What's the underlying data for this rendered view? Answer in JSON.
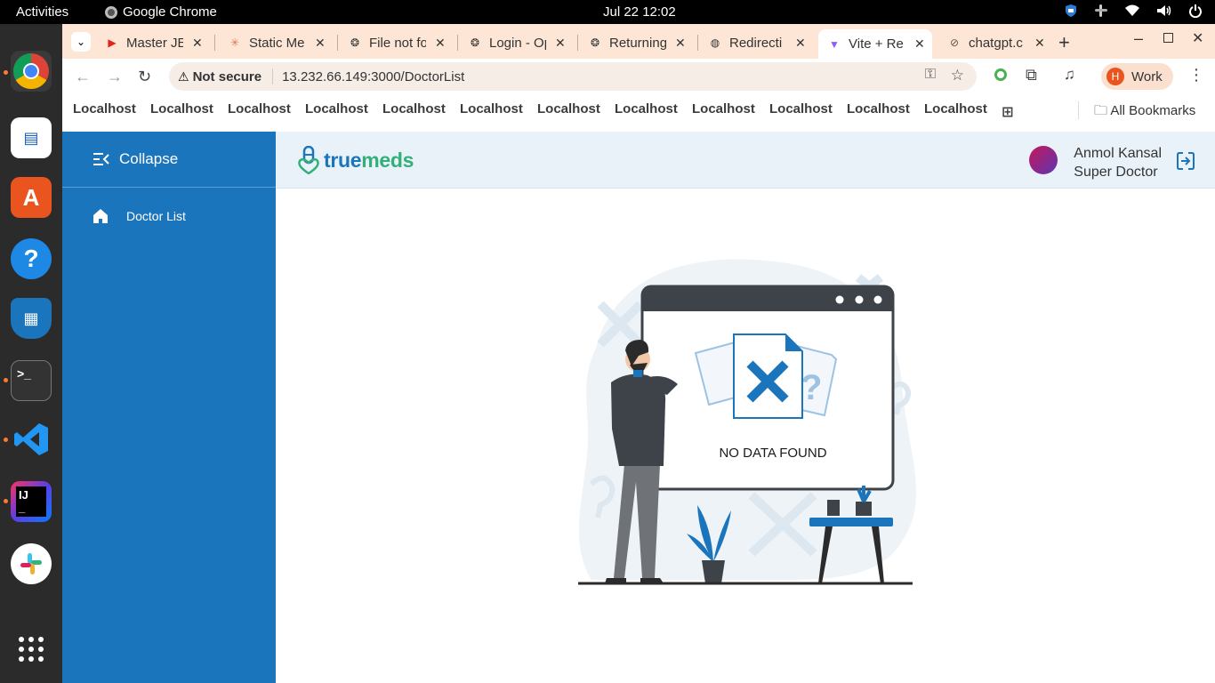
{
  "os": {
    "activities": "Activities",
    "app_name": "Google Chrome",
    "clock": "Jul 22  12:02"
  },
  "browser": {
    "tabs": [
      {
        "label": "Master JE",
        "icon": "youtube-icon",
        "color": "#e62117"
      },
      {
        "label": "Static Me",
        "icon": "claude-icon",
        "color": "#d97757"
      },
      {
        "label": "File not fo",
        "icon": "openai-icon",
        "color": "#333333"
      },
      {
        "label": "Login - Op",
        "icon": "openai-icon",
        "color": "#333333"
      },
      {
        "label": "Returning",
        "icon": "openai-icon",
        "color": "#333333"
      },
      {
        "label": "Redirecti",
        "icon": "globe-icon",
        "color": "#333333"
      },
      {
        "label": "Vite + Re",
        "icon": "vite-icon",
        "color": "#8e5cf7",
        "active": true
      },
      {
        "label": "chatgpt.c",
        "icon": "link-icon",
        "color": "#555555"
      }
    ],
    "security_label": "Not secure",
    "url": "13.232.66.149:3000/DoctorList",
    "profile_initial": "H",
    "profile_label": "Work",
    "bookmarks": [
      "Localhost",
      "Localhost",
      "Localhost",
      "Localhost",
      "Localhost",
      "Localhost",
      "Localhost",
      "Localhost",
      "Localhost",
      "Localhost",
      "Localhost",
      "Localhost"
    ],
    "all_bookmarks": "All Bookmarks"
  },
  "app": {
    "sidebar": {
      "collapse_label": "Collapse",
      "items": [
        {
          "label": "Doctor List",
          "icon": "home-icon"
        }
      ]
    },
    "brand": {
      "part1": "true",
      "part2": "meds"
    },
    "user": {
      "name": "Anmol Kansal",
      "role": "Super Doctor"
    },
    "empty_state": {
      "message": "NO DATA FOUND"
    }
  },
  "colors": {
    "sidebar": "#1b75bc",
    "header": "#eaf2f9",
    "brand_blue": "#1b75bc",
    "brand_green": "#33b07a",
    "tabstrip": "#fde6d6"
  }
}
